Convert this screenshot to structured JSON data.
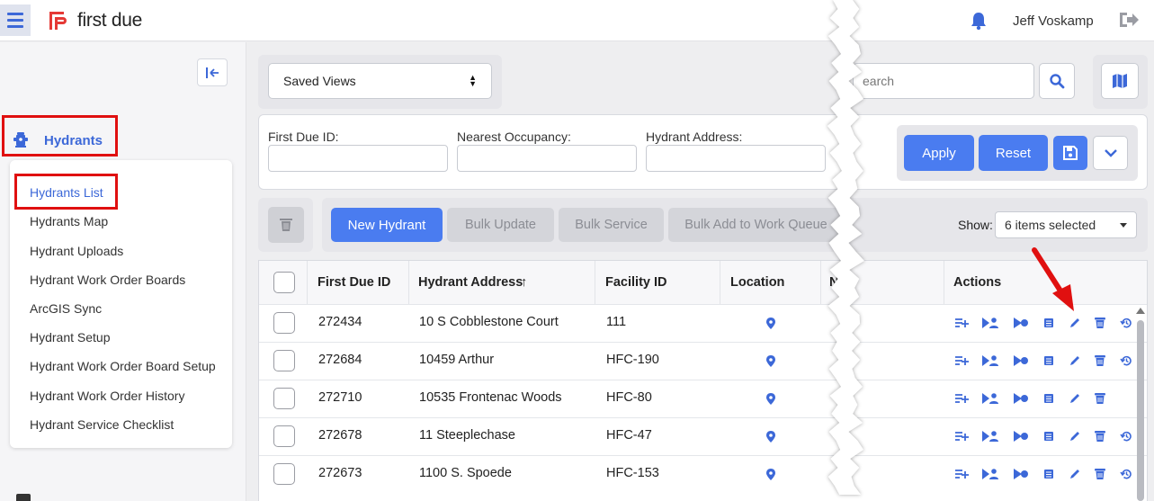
{
  "header": {
    "logo_text": "first due",
    "username": "Jeff Voskamp"
  },
  "sidebar": {
    "section_label": "Hydrants",
    "items": [
      {
        "label": "Hydrants List",
        "active": true
      },
      {
        "label": "Hydrants Map"
      },
      {
        "label": "Hydrant Uploads"
      },
      {
        "label": "Hydrant Work Order Boards"
      },
      {
        "label": "ArcGIS Sync"
      },
      {
        "label": "Hydrant Setup"
      },
      {
        "label": "Hydrant Work Order Board Setup"
      },
      {
        "label": "Hydrant Work Order History"
      },
      {
        "label": "Hydrant Service Checklist"
      }
    ]
  },
  "views": {
    "saved_views": "Saved Views"
  },
  "search": {
    "placeholder": "earch"
  },
  "filters": {
    "first_due_id_label": "First Due ID:",
    "nearest_occupancy_label": "Nearest Occupancy:",
    "hydrant_address_label": "Hydrant Address:",
    "apply_label": "Apply",
    "reset_label": "Reset"
  },
  "toolbar": {
    "new_hydrant": "New Hydrant",
    "bulk_update": "Bulk Update",
    "bulk_service": "Bulk Service",
    "bulk_add_queue": "Bulk Add to Work Queue",
    "show_label": "Show:",
    "show_value": "6 items selected"
  },
  "table": {
    "columns": [
      "First Due ID",
      "Hydrant Address",
      "Facility ID",
      "Location",
      "N",
      "Actions"
    ],
    "sort_indicator": "↑",
    "rows": [
      {
        "id": "272434",
        "address": "10 S Cobblestone Court",
        "facility": "111"
      },
      {
        "id": "272684",
        "address": "10459 Arthur",
        "facility": "HFC-190"
      },
      {
        "id": "272710",
        "address": "10535 Frontenac Woods",
        "facility": "HFC-80"
      },
      {
        "id": "272678",
        "address": "11 Steeplechase",
        "facility": "HFC-47"
      },
      {
        "id": "272673",
        "address": "1100 S. Spoede",
        "facility": "HFC-153"
      }
    ]
  },
  "colors": {
    "accent": "#4a7cf0",
    "highlight_red": "#e01010",
    "logo_red": "#e53935"
  },
  "icons": [
    "menu-icon",
    "bell-icon",
    "logout-icon",
    "collapse-icon",
    "hydrant-icon",
    "search-icon",
    "map-icon",
    "save-icon",
    "chevron-down-icon",
    "trash-icon",
    "location-pin-icon",
    "add-list-icon",
    "forward-person-icon",
    "forward-icon",
    "list-icon",
    "edit-icon",
    "delete-icon",
    "history-icon"
  ]
}
